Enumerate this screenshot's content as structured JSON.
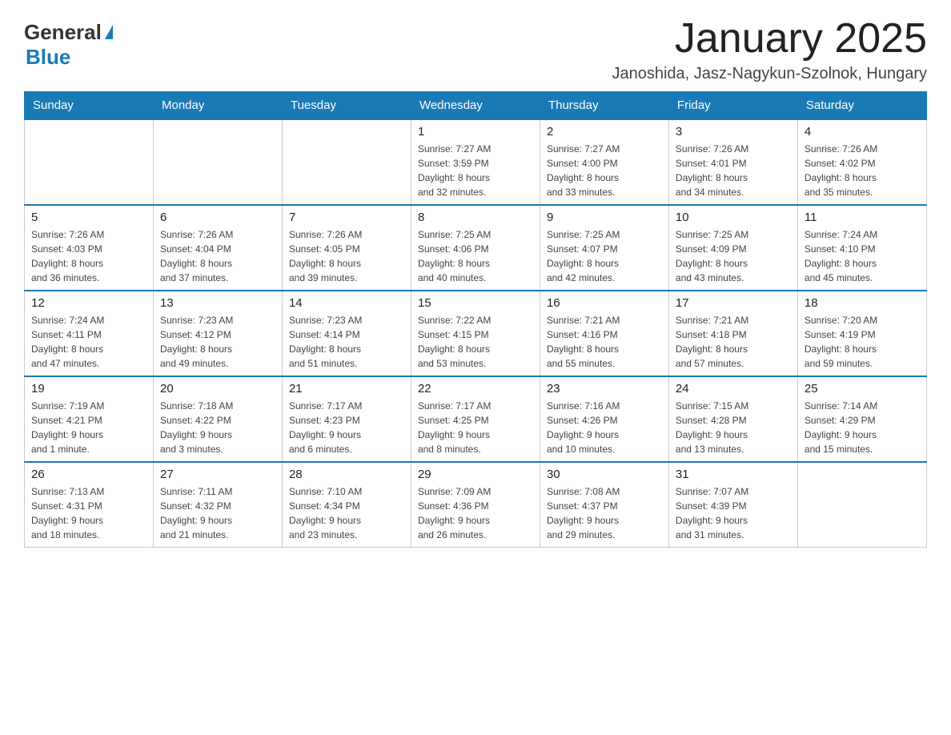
{
  "header": {
    "logo_general": "General",
    "logo_blue": "Blue",
    "month_title": "January 2025",
    "location": "Janoshida, Jasz-Nagykun-Szolnok, Hungary"
  },
  "weekdays": [
    "Sunday",
    "Monday",
    "Tuesday",
    "Wednesday",
    "Thursday",
    "Friday",
    "Saturday"
  ],
  "weeks": [
    [
      {
        "day": "",
        "info": ""
      },
      {
        "day": "",
        "info": ""
      },
      {
        "day": "",
        "info": ""
      },
      {
        "day": "1",
        "info": "Sunrise: 7:27 AM\nSunset: 3:59 PM\nDaylight: 8 hours\nand 32 minutes."
      },
      {
        "day": "2",
        "info": "Sunrise: 7:27 AM\nSunset: 4:00 PM\nDaylight: 8 hours\nand 33 minutes."
      },
      {
        "day": "3",
        "info": "Sunrise: 7:26 AM\nSunset: 4:01 PM\nDaylight: 8 hours\nand 34 minutes."
      },
      {
        "day": "4",
        "info": "Sunrise: 7:26 AM\nSunset: 4:02 PM\nDaylight: 8 hours\nand 35 minutes."
      }
    ],
    [
      {
        "day": "5",
        "info": "Sunrise: 7:26 AM\nSunset: 4:03 PM\nDaylight: 8 hours\nand 36 minutes."
      },
      {
        "day": "6",
        "info": "Sunrise: 7:26 AM\nSunset: 4:04 PM\nDaylight: 8 hours\nand 37 minutes."
      },
      {
        "day": "7",
        "info": "Sunrise: 7:26 AM\nSunset: 4:05 PM\nDaylight: 8 hours\nand 39 minutes."
      },
      {
        "day": "8",
        "info": "Sunrise: 7:25 AM\nSunset: 4:06 PM\nDaylight: 8 hours\nand 40 minutes."
      },
      {
        "day": "9",
        "info": "Sunrise: 7:25 AM\nSunset: 4:07 PM\nDaylight: 8 hours\nand 42 minutes."
      },
      {
        "day": "10",
        "info": "Sunrise: 7:25 AM\nSunset: 4:09 PM\nDaylight: 8 hours\nand 43 minutes."
      },
      {
        "day": "11",
        "info": "Sunrise: 7:24 AM\nSunset: 4:10 PM\nDaylight: 8 hours\nand 45 minutes."
      }
    ],
    [
      {
        "day": "12",
        "info": "Sunrise: 7:24 AM\nSunset: 4:11 PM\nDaylight: 8 hours\nand 47 minutes."
      },
      {
        "day": "13",
        "info": "Sunrise: 7:23 AM\nSunset: 4:12 PM\nDaylight: 8 hours\nand 49 minutes."
      },
      {
        "day": "14",
        "info": "Sunrise: 7:23 AM\nSunset: 4:14 PM\nDaylight: 8 hours\nand 51 minutes."
      },
      {
        "day": "15",
        "info": "Sunrise: 7:22 AM\nSunset: 4:15 PM\nDaylight: 8 hours\nand 53 minutes."
      },
      {
        "day": "16",
        "info": "Sunrise: 7:21 AM\nSunset: 4:16 PM\nDaylight: 8 hours\nand 55 minutes."
      },
      {
        "day": "17",
        "info": "Sunrise: 7:21 AM\nSunset: 4:18 PM\nDaylight: 8 hours\nand 57 minutes."
      },
      {
        "day": "18",
        "info": "Sunrise: 7:20 AM\nSunset: 4:19 PM\nDaylight: 8 hours\nand 59 minutes."
      }
    ],
    [
      {
        "day": "19",
        "info": "Sunrise: 7:19 AM\nSunset: 4:21 PM\nDaylight: 9 hours\nand 1 minute."
      },
      {
        "day": "20",
        "info": "Sunrise: 7:18 AM\nSunset: 4:22 PM\nDaylight: 9 hours\nand 3 minutes."
      },
      {
        "day": "21",
        "info": "Sunrise: 7:17 AM\nSunset: 4:23 PM\nDaylight: 9 hours\nand 6 minutes."
      },
      {
        "day": "22",
        "info": "Sunrise: 7:17 AM\nSunset: 4:25 PM\nDaylight: 9 hours\nand 8 minutes."
      },
      {
        "day": "23",
        "info": "Sunrise: 7:16 AM\nSunset: 4:26 PM\nDaylight: 9 hours\nand 10 minutes."
      },
      {
        "day": "24",
        "info": "Sunrise: 7:15 AM\nSunset: 4:28 PM\nDaylight: 9 hours\nand 13 minutes."
      },
      {
        "day": "25",
        "info": "Sunrise: 7:14 AM\nSunset: 4:29 PM\nDaylight: 9 hours\nand 15 minutes."
      }
    ],
    [
      {
        "day": "26",
        "info": "Sunrise: 7:13 AM\nSunset: 4:31 PM\nDaylight: 9 hours\nand 18 minutes."
      },
      {
        "day": "27",
        "info": "Sunrise: 7:11 AM\nSunset: 4:32 PM\nDaylight: 9 hours\nand 21 minutes."
      },
      {
        "day": "28",
        "info": "Sunrise: 7:10 AM\nSunset: 4:34 PM\nDaylight: 9 hours\nand 23 minutes."
      },
      {
        "day": "29",
        "info": "Sunrise: 7:09 AM\nSunset: 4:36 PM\nDaylight: 9 hours\nand 26 minutes."
      },
      {
        "day": "30",
        "info": "Sunrise: 7:08 AM\nSunset: 4:37 PM\nDaylight: 9 hours\nand 29 minutes."
      },
      {
        "day": "31",
        "info": "Sunrise: 7:07 AM\nSunset: 4:39 PM\nDaylight: 9 hours\nand 31 minutes."
      },
      {
        "day": "",
        "info": ""
      }
    ]
  ]
}
